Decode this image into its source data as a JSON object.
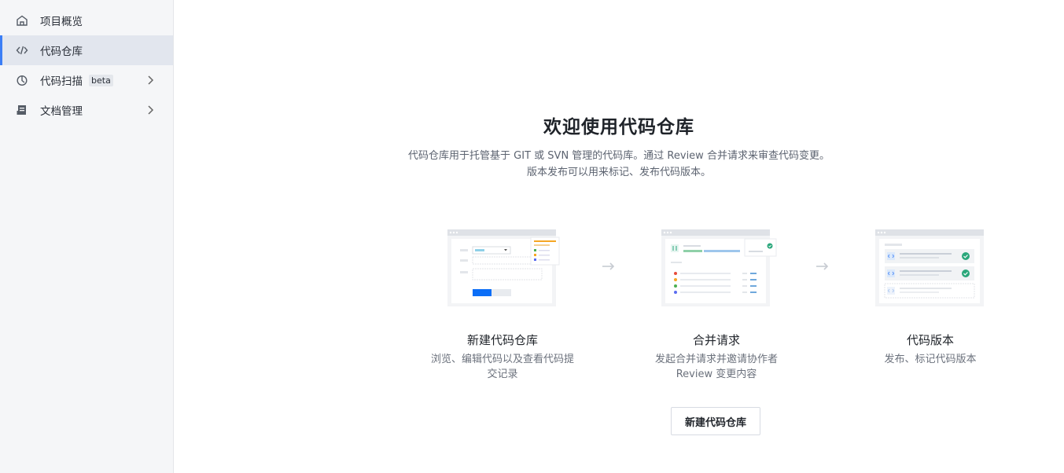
{
  "sidebar": {
    "items": [
      {
        "label": "项目概览",
        "icon": "home-icon",
        "active": false,
        "badge": "",
        "has_chevron": false
      },
      {
        "label": "代码仓库",
        "icon": "code-icon",
        "active": true,
        "badge": "",
        "has_chevron": false
      },
      {
        "label": "代码扫描",
        "icon": "scan-icon",
        "active": false,
        "badge": "beta",
        "has_chevron": true
      },
      {
        "label": "文档管理",
        "icon": "document-icon",
        "active": false,
        "badge": "",
        "has_chevron": true
      }
    ]
  },
  "main": {
    "title": "欢迎使用代码仓库",
    "description_line1": "代码仓库用于托管基于 GIT 或 SVN 管理的代码库。通过 Review 合并请求来审查代码变更。",
    "description_line2": "版本发布可以用来标记、发布代码版本。",
    "features": [
      {
        "title": "新建代码仓库",
        "description": "浏览、编辑代码以及查看代码提交记录"
      },
      {
        "title": "合并请求",
        "description": "发起合并请求并邀请协作者 Review 变更内容"
      },
      {
        "title": "代码版本",
        "description": "发布、标记代码版本"
      }
    ],
    "create_button_label": "新建代码仓库"
  },
  "colors": {
    "accent": "#3b7ef6",
    "sidebar_bg": "#f5f6f8",
    "active_bg": "#e2e6ee"
  }
}
